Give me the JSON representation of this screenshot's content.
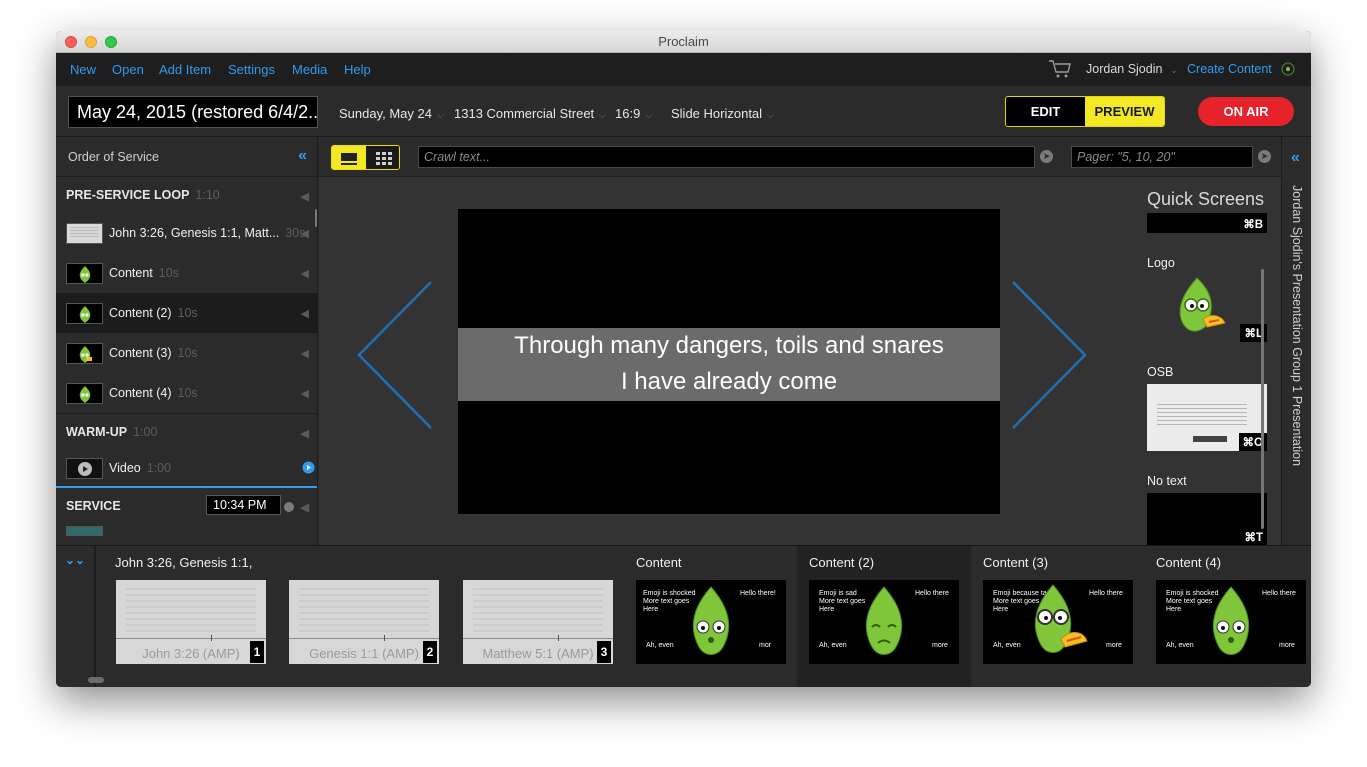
{
  "window": {
    "title": "Proclaim"
  },
  "menu": {
    "items": [
      "New",
      "Open",
      "Add Item",
      "Settings",
      "Media",
      "Help"
    ],
    "user": "Jordan Sjodin",
    "create_content": "Create Content"
  },
  "toolbar": {
    "presentation_name": "May 24, 2015 (restored 6/4/2...",
    "date": "Sunday, May 24",
    "location": "1313 Commercial Street",
    "aspect": "16:9",
    "transition": "Slide Horizontal",
    "edit_label": "EDIT",
    "preview_label": "PREVIEW",
    "onair_label": "ON AIR"
  },
  "order_of_service": {
    "header": "Order of Service",
    "sections": [
      {
        "name": "PRE-SERVICE LOOP",
        "duration": "1:10",
        "items": [
          {
            "title": "John 3:26, Genesis 1:1, Matt...",
            "duration": "30s",
            "thumb": "doc"
          },
          {
            "title": "Content",
            "duration": "10s",
            "thumb": "leaf"
          },
          {
            "title": "Content (2)",
            "duration": "10s",
            "thumb": "leaf"
          },
          {
            "title": "Content (3)",
            "duration": "10s",
            "thumb": "leaf"
          },
          {
            "title": "Content (4)",
            "duration": "10s",
            "thumb": "leaf"
          }
        ]
      },
      {
        "name": "WARM-UP",
        "duration": "1:00",
        "items": [
          {
            "title": "Video",
            "duration": "1:00",
            "thumb": "video"
          }
        ]
      },
      {
        "name": "SERVICE",
        "time": "10:34 PM",
        "items": []
      }
    ]
  },
  "center": {
    "crawl_placeholder": "Crawl text...",
    "pager_placeholder": "Pager: \"5, 10, 20\"",
    "lyric_line1": "Through many dangers, toils and snares",
    "lyric_line2": "I have already come"
  },
  "quick_screens": {
    "title": "Quick Screens",
    "items": [
      {
        "label": "",
        "shortcut": "⌘B"
      },
      {
        "label": "Logo",
        "shortcut": "⌘L"
      },
      {
        "label": "OSB",
        "shortcut": "⌘O"
      },
      {
        "label": "No text",
        "shortcut": "⌘T"
      }
    ]
  },
  "right_rail": {
    "text": "Jordan Sjodin's Presentation Group 1 Presentation"
  },
  "filmstrip": {
    "groups": [
      {
        "title": "John 3:26, Genesis 1:1,",
        "slides": [
          {
            "ref": "John 3:26 (AMP)",
            "num": "1"
          },
          {
            "ref": "Genesis 1:1 (AMP)",
            "num": "2"
          },
          {
            "ref": "Matthew 5:1 (AMP)",
            "num": "3"
          }
        ]
      },
      {
        "title": "Content",
        "left_text": "Emoji is shocked\nMore text goes\nHere",
        "right_text": "Hello there!",
        "bottom_left": "Ah, even",
        "bottom_right": "mor"
      },
      {
        "title": "Content (2)",
        "left_text": "Emoji is sad\nMore text goes\nHere",
        "right_text": "Hello there",
        "bottom_left": "Ah, even",
        "bottom_right": "more"
      },
      {
        "title": "Content (3)",
        "left_text": "Emoji because taco\nMore text goes\nHere",
        "right_text": "Hello there",
        "bottom_left": "Ah, even",
        "bottom_right": "more"
      },
      {
        "title": "Content (4)",
        "left_text": "Emoji is shocked\nMore text goes\nHere",
        "right_text": "Hello there",
        "bottom_left": "Ah, even",
        "bottom_right": "more"
      }
    ]
  },
  "colors": {
    "accent": "#2f9bf0",
    "highlight": "#f3e826",
    "onair": "#e6222a",
    "leaf": "#7fc63a"
  }
}
